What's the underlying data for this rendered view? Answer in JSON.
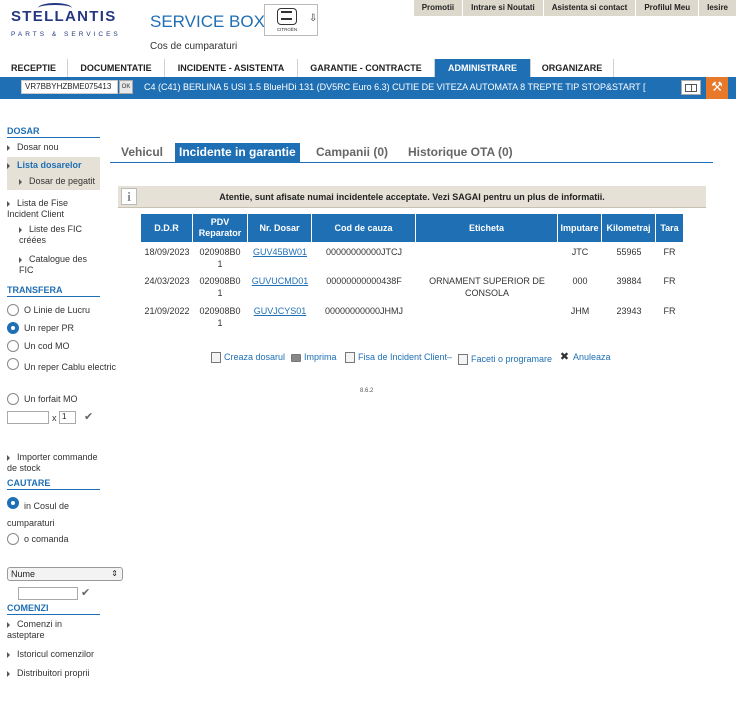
{
  "header": {
    "logo_main": "STELLANTIS",
    "logo_sub": "PARTS & SERVICES",
    "app_title": "SERVICE BOX",
    "app_subtitle": "Cos de cumparaturi",
    "brand_name": "CITROËN",
    "brand_arrow": "⇩"
  },
  "topnav": [
    "Promotii",
    "Intrare si Noutati",
    "Asistenta si contact",
    "Profilul Meu",
    "Iesire"
  ],
  "mainnav": {
    "tabs": [
      "RECEPTIE",
      "DOCUMENTATIE",
      "INCIDENTE - ASISTENTA",
      "GARANTIE - CONTRACTE",
      "ADMINISTRARE",
      "ORGANIZARE"
    ],
    "active_index": 4
  },
  "vinbar": {
    "vin": "VR7BBYHZBME075413",
    "ok_label": "OK",
    "description": "C4 (C41) BERLINA 5 USI 1.5 BlueHDi 131 (DV5RC Euro 6.3) CUTIE DE VITEZA AUTOMATA 8 TREPTE TIP STOP&START  [",
    "tool_icon": "wrench-icon"
  },
  "sidebar": {
    "dosar_title": "DOSAR",
    "dosar_nou": "Dosar nou",
    "lista_dosarelor": "Lista dosarelor",
    "dosar_pegatit": "Dosar de pegatit",
    "lista_fise": "Lista de Fise Incident Client",
    "liste_fic": "Liste des FIC créées",
    "catalogue_fic": "Catalogue des FIC",
    "transfera_title": "TRANSFERA",
    "transfera_options": [
      "O Linie de Lucru",
      "Un reper PR",
      "Un cod MO",
      "Un reper Cablu electric",
      "Un forfait MO"
    ],
    "transfera_selected": 1,
    "qty_value": "1",
    "qty_x": "x",
    "importer": "Importer commande de stock",
    "cautare_title": "CAUTARE",
    "cautare_options": [
      "in Cosul de cumparaturi",
      "o comanda"
    ],
    "cautare_selected": 0,
    "select_value": "Nume",
    "comenzi_title": "COMENZI",
    "comenzi_items": [
      "Comenzi in asteptare",
      "Istoricul comenzilor",
      "Distribuitori proprii"
    ]
  },
  "content_tabs": {
    "tabs": [
      "Vehicul",
      "Incidente in garantie",
      "Campanii (0)",
      "Historique OTA (0)"
    ],
    "active_index": 1
  },
  "notice": "Atentie, sunt afisate numai incidentele acceptate. Vezi SAGAI pentru un plus de informatii.",
  "table": {
    "headers": [
      "D.D.R",
      "PDV Reparator",
      "Nr. Dosar",
      "Cod de cauza",
      "Eticheta",
      "Imputare",
      "Kilometraj",
      "Tara"
    ],
    "rows": [
      [
        "18/09/2023",
        "020908B01",
        "GUV45BW01",
        "00000000000JTCJ",
        "",
        "JTC",
        "55965",
        "FR"
      ],
      [
        "24/03/2023",
        "020908B01",
        "GUVUCMD01",
        "00000000000438F",
        "ORNAMENT SUPERIOR DE CONSOLA",
        "000",
        "39884",
        "FR"
      ],
      [
        "21/09/2022",
        "020908B01",
        "GUVJCYS01",
        "00000000000JHMJ",
        "",
        "JHM",
        "23943",
        "FR"
      ]
    ]
  },
  "actions": [
    "Creaza dosarul",
    "Imprima",
    "Fisa de Incident Client–",
    "Faceti o programare",
    "Anuleaza"
  ],
  "version": "8.6.2",
  "colors": {
    "accent": "#1f6fb5",
    "beige": "#e6e1d6",
    "tool_orange": "#e8782a"
  }
}
